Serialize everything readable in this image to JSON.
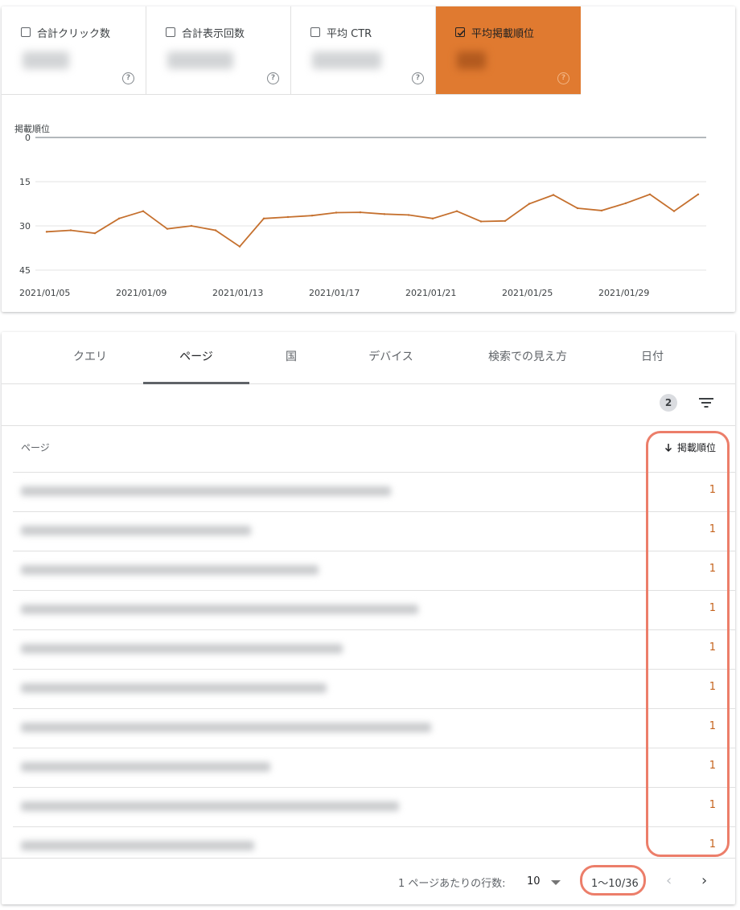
{
  "metrics": [
    {
      "label": "合計クリック数",
      "selected": false
    },
    {
      "label": "合計表示回数",
      "selected": false
    },
    {
      "label": "平均 CTR",
      "selected": false
    },
    {
      "label": "平均掲載順位",
      "selected": true
    }
  ],
  "colors": {
    "accent": "#e07a30",
    "value_text": "#c5631d",
    "highlight": "#ec7e6a"
  },
  "chart_data": {
    "type": "line",
    "ylabel": "掲載順位",
    "y_inverted": true,
    "ylim": [
      0,
      45
    ],
    "yticks": [
      0,
      15,
      30,
      45
    ],
    "x": [
      "2021/01/05",
      "2021/01/06",
      "2021/01/07",
      "2021/01/08",
      "2021/01/09",
      "2021/01/10",
      "2021/01/11",
      "2021/01/12",
      "2021/01/13",
      "2021/01/14",
      "2021/01/15",
      "2021/01/16",
      "2021/01/17",
      "2021/01/18",
      "2021/01/19",
      "2021/01/20",
      "2021/01/21",
      "2021/01/22",
      "2021/01/23",
      "2021/01/24",
      "2021/01/25",
      "2021/01/26",
      "2021/01/27",
      "2021/01/28",
      "2021/01/29",
      "2021/01/30",
      "2021/01/31",
      "2021/02/01",
      "2021/02/02"
    ],
    "xtick_labels": [
      "2021/01/05",
      "2021/01/09",
      "2021/01/13",
      "2021/01/17",
      "2021/01/21",
      "2021/01/25",
      "2021/01/29"
    ],
    "series": [
      {
        "values": [
          32,
          31.5,
          32.5,
          27.5,
          25,
          31,
          30,
          31.5,
          37,
          27.5,
          27,
          26.5,
          25.5,
          25.4,
          26,
          26.3,
          27.5,
          25,
          28.5,
          28.3,
          22.5,
          19.5,
          24,
          24.8,
          22.3,
          19.3,
          25,
          19.3
        ]
      }
    ],
    "grid": true
  },
  "tabs": [
    {
      "label": "クエリ",
      "active": false
    },
    {
      "label": "ページ",
      "active": true
    },
    {
      "label": "国",
      "active": false
    },
    {
      "label": "デバイス",
      "active": false
    },
    {
      "label": "検索での見え方",
      "active": false
    },
    {
      "label": "日付",
      "active": false
    }
  ],
  "toolbar": {
    "filter_count": "2"
  },
  "table": {
    "col_page": "ページ",
    "col_position": "掲載順位",
    "rows": [
      {
        "position": "1"
      },
      {
        "position": "1"
      },
      {
        "position": "1"
      },
      {
        "position": "1"
      },
      {
        "position": "1"
      },
      {
        "position": "1"
      },
      {
        "position": "1"
      },
      {
        "position": "1"
      },
      {
        "position": "1"
      },
      {
        "position": "1"
      }
    ]
  },
  "pagination": {
    "rows_per_page_label": "1 ページあたりの行数:",
    "rows_per_page": "10",
    "range": "1〜10/36"
  }
}
